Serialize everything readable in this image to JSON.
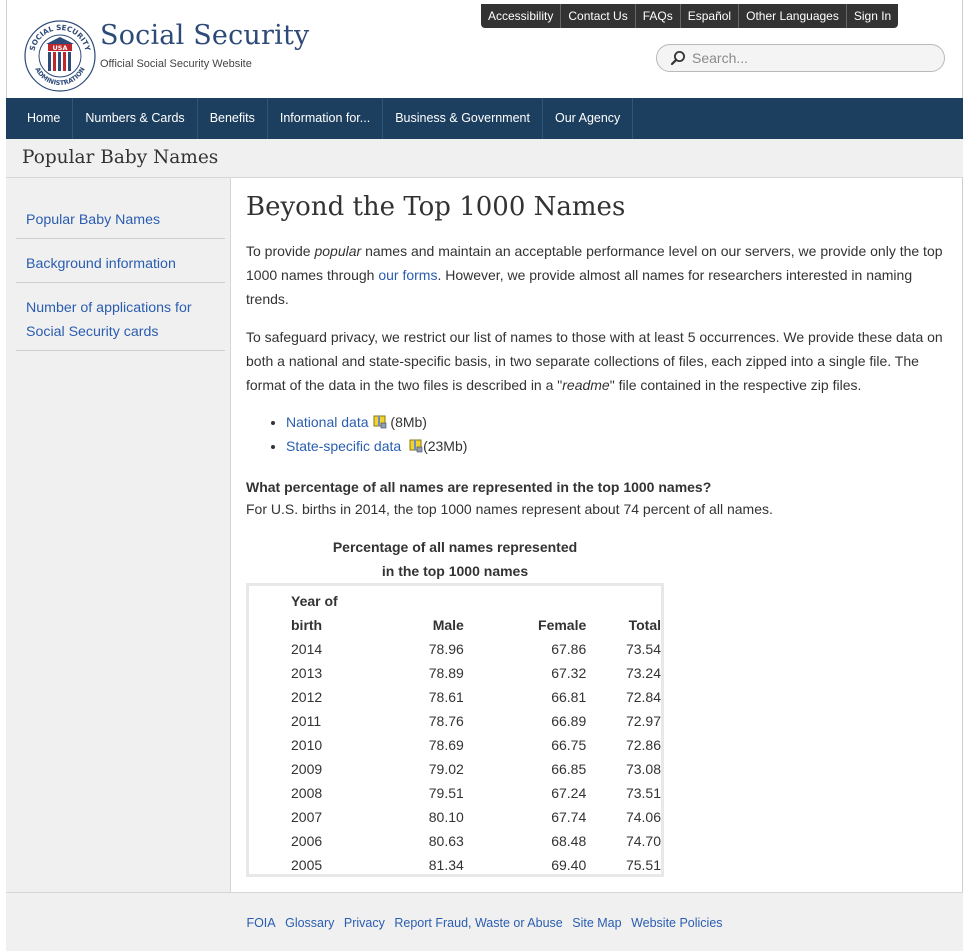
{
  "header": {
    "brand_name": "Social Security",
    "brand_tag": "Official Social Security Website",
    "seal_text_top": "SOCIAL SECURITY",
    "seal_text_bottom": "ADMINISTRATION",
    "seal_center": "USA",
    "utility_links": [
      "Accessibility",
      "Contact Us",
      "FAQs",
      "Español",
      "Other Languages",
      "Sign In"
    ],
    "search_placeholder": "Search..."
  },
  "nav": {
    "items": [
      "Home",
      "Numbers & Cards",
      "Benefits",
      "Information for...",
      "Business & Government",
      "Our Agency"
    ]
  },
  "section_title": "Popular Baby Names",
  "sidebar": {
    "items": [
      "Popular Baby Names",
      "Background information",
      "Number of applications for Social Security cards"
    ]
  },
  "main": {
    "title": "Beyond the Top 1000 Names",
    "p1": {
      "a": "To provide ",
      "em": "popular",
      "b": " names and maintain an acceptable performance level on our servers, we provide only the top 1000 names through ",
      "link": "our forms",
      "c": ". However, we provide almost all names for researchers interested in naming trends."
    },
    "p2": {
      "a": "To safeguard privacy, we restrict our list of names to those with at least 5 occurrences. We provide these data on both a national and state-specific basis, in two separate collections of files, each zipped into a single file. The format of the data in the two files is described in a \"",
      "em": "readme",
      "b": "\" file contained in the respective zip files."
    },
    "downloads": [
      {
        "label": "National data",
        "size": "(8Mb)"
      },
      {
        "label": "State-specific data",
        "size": "(23Mb)"
      }
    ],
    "question": "What percentage of all names are represented in the top 1000 names?",
    "answer": "For U.S. births in 2014, the top 1000 names represent about 74 percent of all names.",
    "table": {
      "caption_line1": "Percentage of all names represented",
      "caption_line2": "in the top 1000 names",
      "headers": {
        "year_line1": "Year of",
        "year_line2": "birth",
        "male": "Male",
        "female": "Female",
        "total": "Total"
      },
      "rows": [
        [
          "2014",
          "78.96",
          "67.86",
          "73.54"
        ],
        [
          "2013",
          "78.89",
          "67.32",
          "73.24"
        ],
        [
          "2012",
          "78.61",
          "66.81",
          "72.84"
        ],
        [
          "2011",
          "78.76",
          "66.89",
          "72.97"
        ],
        [
          "2010",
          "78.69",
          "66.75",
          "72.86"
        ],
        [
          "2009",
          "79.02",
          "66.85",
          "73.08"
        ],
        [
          "2008",
          "79.51",
          "67.24",
          "73.51"
        ],
        [
          "2007",
          "80.10",
          "67.74",
          "74.06"
        ],
        [
          "2006",
          "80.63",
          "68.48",
          "74.70"
        ],
        [
          "2005",
          "81.34",
          "69.40",
          "75.51"
        ]
      ]
    }
  },
  "footer": {
    "links": [
      "FOIA",
      "Glossary",
      "Privacy",
      "Report Fraud, Waste or Abuse",
      "Site Map",
      "Website Policies"
    ]
  },
  "colors": {
    "nav_bg": "#1d3f5f",
    "link": "#2a5db0",
    "brand": "#2d4a78",
    "utility_bg": "#333333",
    "panel_bg": "#f0f0f0"
  }
}
